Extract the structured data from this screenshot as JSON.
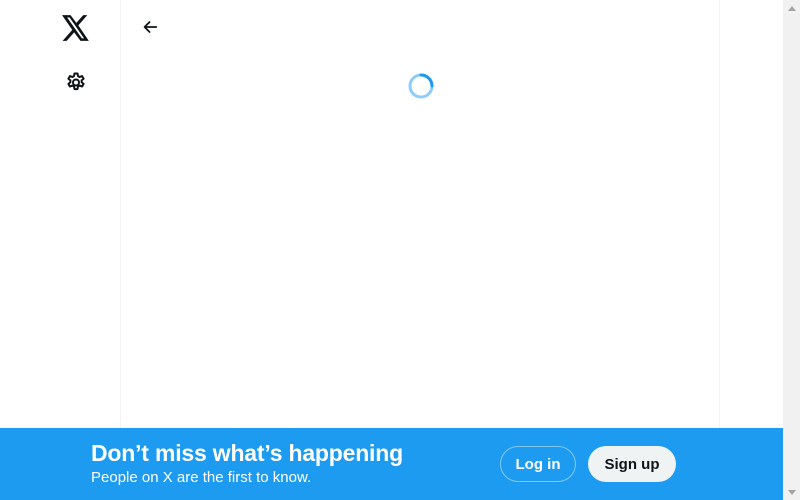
{
  "nav": {
    "logo_icon": "x-logo-icon",
    "settings_icon": "gear-icon",
    "back_icon": "arrow-left-icon"
  },
  "main": {
    "loading_icon": "loading-spinner-icon"
  },
  "bottom_bar": {
    "headline": "Don’t miss what’s happening",
    "subtext": "People on X are the first to know.",
    "login_label": "Log in",
    "signup_label": "Sign up",
    "background_color": "#1d9bf0"
  },
  "colors": {
    "accent": "#1d9bf0",
    "text": "#0f1419",
    "border": "#eff3f4"
  }
}
